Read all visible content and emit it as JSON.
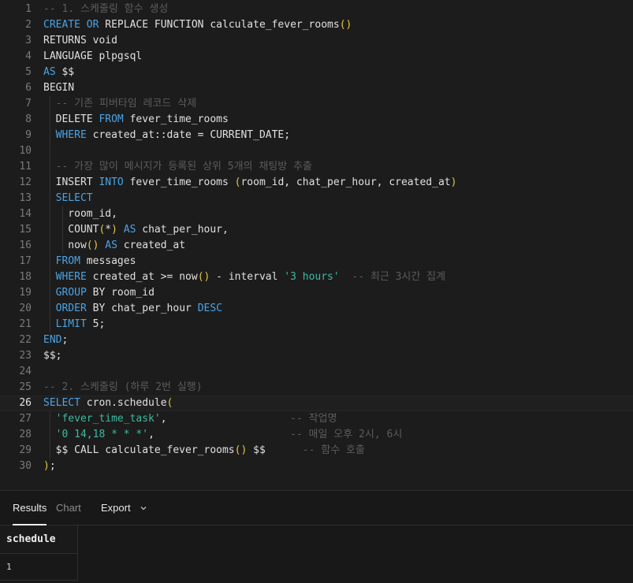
{
  "editor": {
    "active_line": 26,
    "lines": [
      {
        "n": "1",
        "tokens": [
          [
            "comment",
            "-- 1. 스케줄링 함수 생성"
          ]
        ]
      },
      {
        "n": "2",
        "tokens": [
          [
            "kw",
            "CREATE"
          ],
          [
            "plain",
            " "
          ],
          [
            "kw",
            "OR"
          ],
          [
            "plain",
            " REPLACE FUNCTION calculate_fever_rooms"
          ],
          [
            "paren",
            "()"
          ]
        ]
      },
      {
        "n": "3",
        "tokens": [
          [
            "plain",
            "RETURNS void"
          ]
        ]
      },
      {
        "n": "4",
        "tokens": [
          [
            "plain",
            "LANGUAGE plpgsql"
          ]
        ]
      },
      {
        "n": "5",
        "tokens": [
          [
            "kw",
            "AS"
          ],
          [
            "plain",
            " $$"
          ]
        ]
      },
      {
        "n": "6",
        "tokens": [
          [
            "plain",
            "BEGIN"
          ]
        ]
      },
      {
        "n": "7",
        "tokens": [
          [
            "plain",
            "  "
          ],
          [
            "comment",
            "-- 기존 피버타임 레코드 삭제"
          ]
        ]
      },
      {
        "n": "8",
        "tokens": [
          [
            "plain",
            "  DELETE "
          ],
          [
            "kw",
            "FROM"
          ],
          [
            "plain",
            " fever_time_rooms"
          ]
        ]
      },
      {
        "n": "9",
        "tokens": [
          [
            "plain",
            "  "
          ],
          [
            "kw",
            "WHERE"
          ],
          [
            "plain",
            " created_at::date = CURRENT_DATE;"
          ]
        ]
      },
      {
        "n": "10",
        "tokens": []
      },
      {
        "n": "11",
        "tokens": [
          [
            "plain",
            "  "
          ],
          [
            "comment",
            "-- 가장 많이 메시지가 등록된 상위 5개의 채팅방 추출"
          ]
        ]
      },
      {
        "n": "12",
        "tokens": [
          [
            "plain",
            "  INSERT "
          ],
          [
            "kw",
            "INTO"
          ],
          [
            "plain",
            " fever_time_rooms "
          ],
          [
            "paren",
            "("
          ],
          [
            "plain",
            "room_id, chat_per_hour, created_at"
          ],
          [
            "paren",
            ")"
          ]
        ]
      },
      {
        "n": "13",
        "tokens": [
          [
            "plain",
            "  "
          ],
          [
            "kw",
            "SELECT"
          ]
        ]
      },
      {
        "n": "14",
        "tokens": [
          [
            "plain",
            "    room_id,"
          ]
        ]
      },
      {
        "n": "15",
        "tokens": [
          [
            "plain",
            "    COUNT"
          ],
          [
            "paren",
            "("
          ],
          [
            "plain",
            "*"
          ],
          [
            "paren",
            ")"
          ],
          [
            "plain",
            " "
          ],
          [
            "kw",
            "AS"
          ],
          [
            "plain",
            " chat_per_hour,"
          ]
        ]
      },
      {
        "n": "16",
        "tokens": [
          [
            "plain",
            "    now"
          ],
          [
            "paren",
            "()"
          ],
          [
            "plain",
            " "
          ],
          [
            "kw",
            "AS"
          ],
          [
            "plain",
            " created_at"
          ]
        ]
      },
      {
        "n": "17",
        "tokens": [
          [
            "plain",
            "  "
          ],
          [
            "kw",
            "FROM"
          ],
          [
            "plain",
            " messages"
          ]
        ]
      },
      {
        "n": "18",
        "tokens": [
          [
            "plain",
            "  "
          ],
          [
            "kw",
            "WHERE"
          ],
          [
            "plain",
            " created_at >= now"
          ],
          [
            "paren",
            "()"
          ],
          [
            "plain",
            " - interval "
          ],
          [
            "str",
            "'3 hours'"
          ],
          [
            "plain",
            "  "
          ],
          [
            "comment",
            "-- 최근 3시간 집계"
          ]
        ]
      },
      {
        "n": "19",
        "tokens": [
          [
            "plain",
            "  "
          ],
          [
            "kw",
            "GROUP"
          ],
          [
            "plain",
            " BY room_id"
          ]
        ]
      },
      {
        "n": "20",
        "tokens": [
          [
            "plain",
            "  "
          ],
          [
            "kw",
            "ORDER"
          ],
          [
            "plain",
            " BY chat_per_hour "
          ],
          [
            "kw",
            "DESC"
          ]
        ]
      },
      {
        "n": "21",
        "tokens": [
          [
            "plain",
            "  "
          ],
          [
            "kw",
            "LIMIT"
          ],
          [
            "plain",
            " 5;"
          ]
        ]
      },
      {
        "n": "22",
        "tokens": [
          [
            "kw",
            "END"
          ],
          [
            "plain",
            ";"
          ]
        ]
      },
      {
        "n": "23",
        "tokens": [
          [
            "plain",
            "$$;"
          ]
        ]
      },
      {
        "n": "24",
        "tokens": []
      },
      {
        "n": "25",
        "tokens": [
          [
            "comment",
            "-- 2. 스케줄링 (하루 2번 실행)"
          ]
        ]
      },
      {
        "n": "26",
        "tokens": [
          [
            "kw",
            "SELECT"
          ],
          [
            "plain",
            " cron.schedule"
          ],
          [
            "paren",
            "("
          ]
        ]
      },
      {
        "n": "27",
        "tokens": [
          [
            "plain",
            "  "
          ],
          [
            "str",
            "'fever_time_task'"
          ],
          [
            "plain",
            ",                    "
          ],
          [
            "comment",
            "-- 작업명"
          ]
        ]
      },
      {
        "n": "28",
        "tokens": [
          [
            "plain",
            "  "
          ],
          [
            "str",
            "'0 14,18 * * *'"
          ],
          [
            "plain",
            ",                      "
          ],
          [
            "comment",
            "-- 매일 오후 2시, 6시"
          ]
        ]
      },
      {
        "n": "29",
        "tokens": [
          [
            "plain",
            "  $$ CALL calculate_fever_rooms"
          ],
          [
            "paren",
            "()"
          ],
          [
            "plain",
            " $$      "
          ],
          [
            "comment",
            "-- 함수 호출"
          ]
        ]
      },
      {
        "n": "30",
        "tokens": [
          [
            "paren",
            ")"
          ],
          [
            "plain",
            ";"
          ]
        ]
      }
    ]
  },
  "results_panel": {
    "tabs": [
      {
        "label": "Results",
        "active": true
      },
      {
        "label": "Chart",
        "active": false
      },
      {
        "label": "Export",
        "active": false
      }
    ],
    "export_icon": "chevron-down-icon",
    "columns": [
      "schedule"
    ],
    "rows": [
      [
        "1"
      ]
    ]
  }
}
